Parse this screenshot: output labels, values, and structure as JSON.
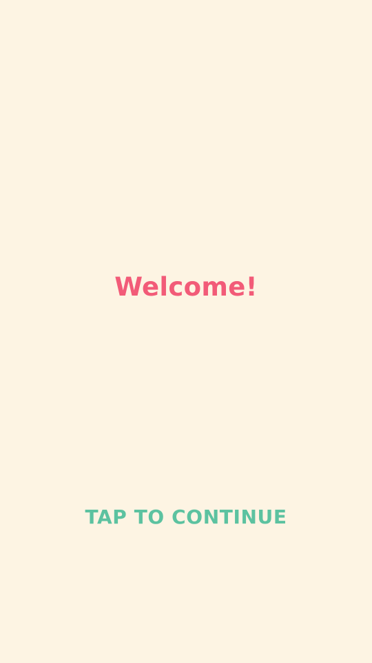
{
  "screen": {
    "background_color": "#FDF4E3"
  },
  "welcome": {
    "text": "Welcome!",
    "color": "#F25B78"
  },
  "continue": {
    "label": "TAP TO CONTINUE",
    "color": "#5CC2A0"
  }
}
